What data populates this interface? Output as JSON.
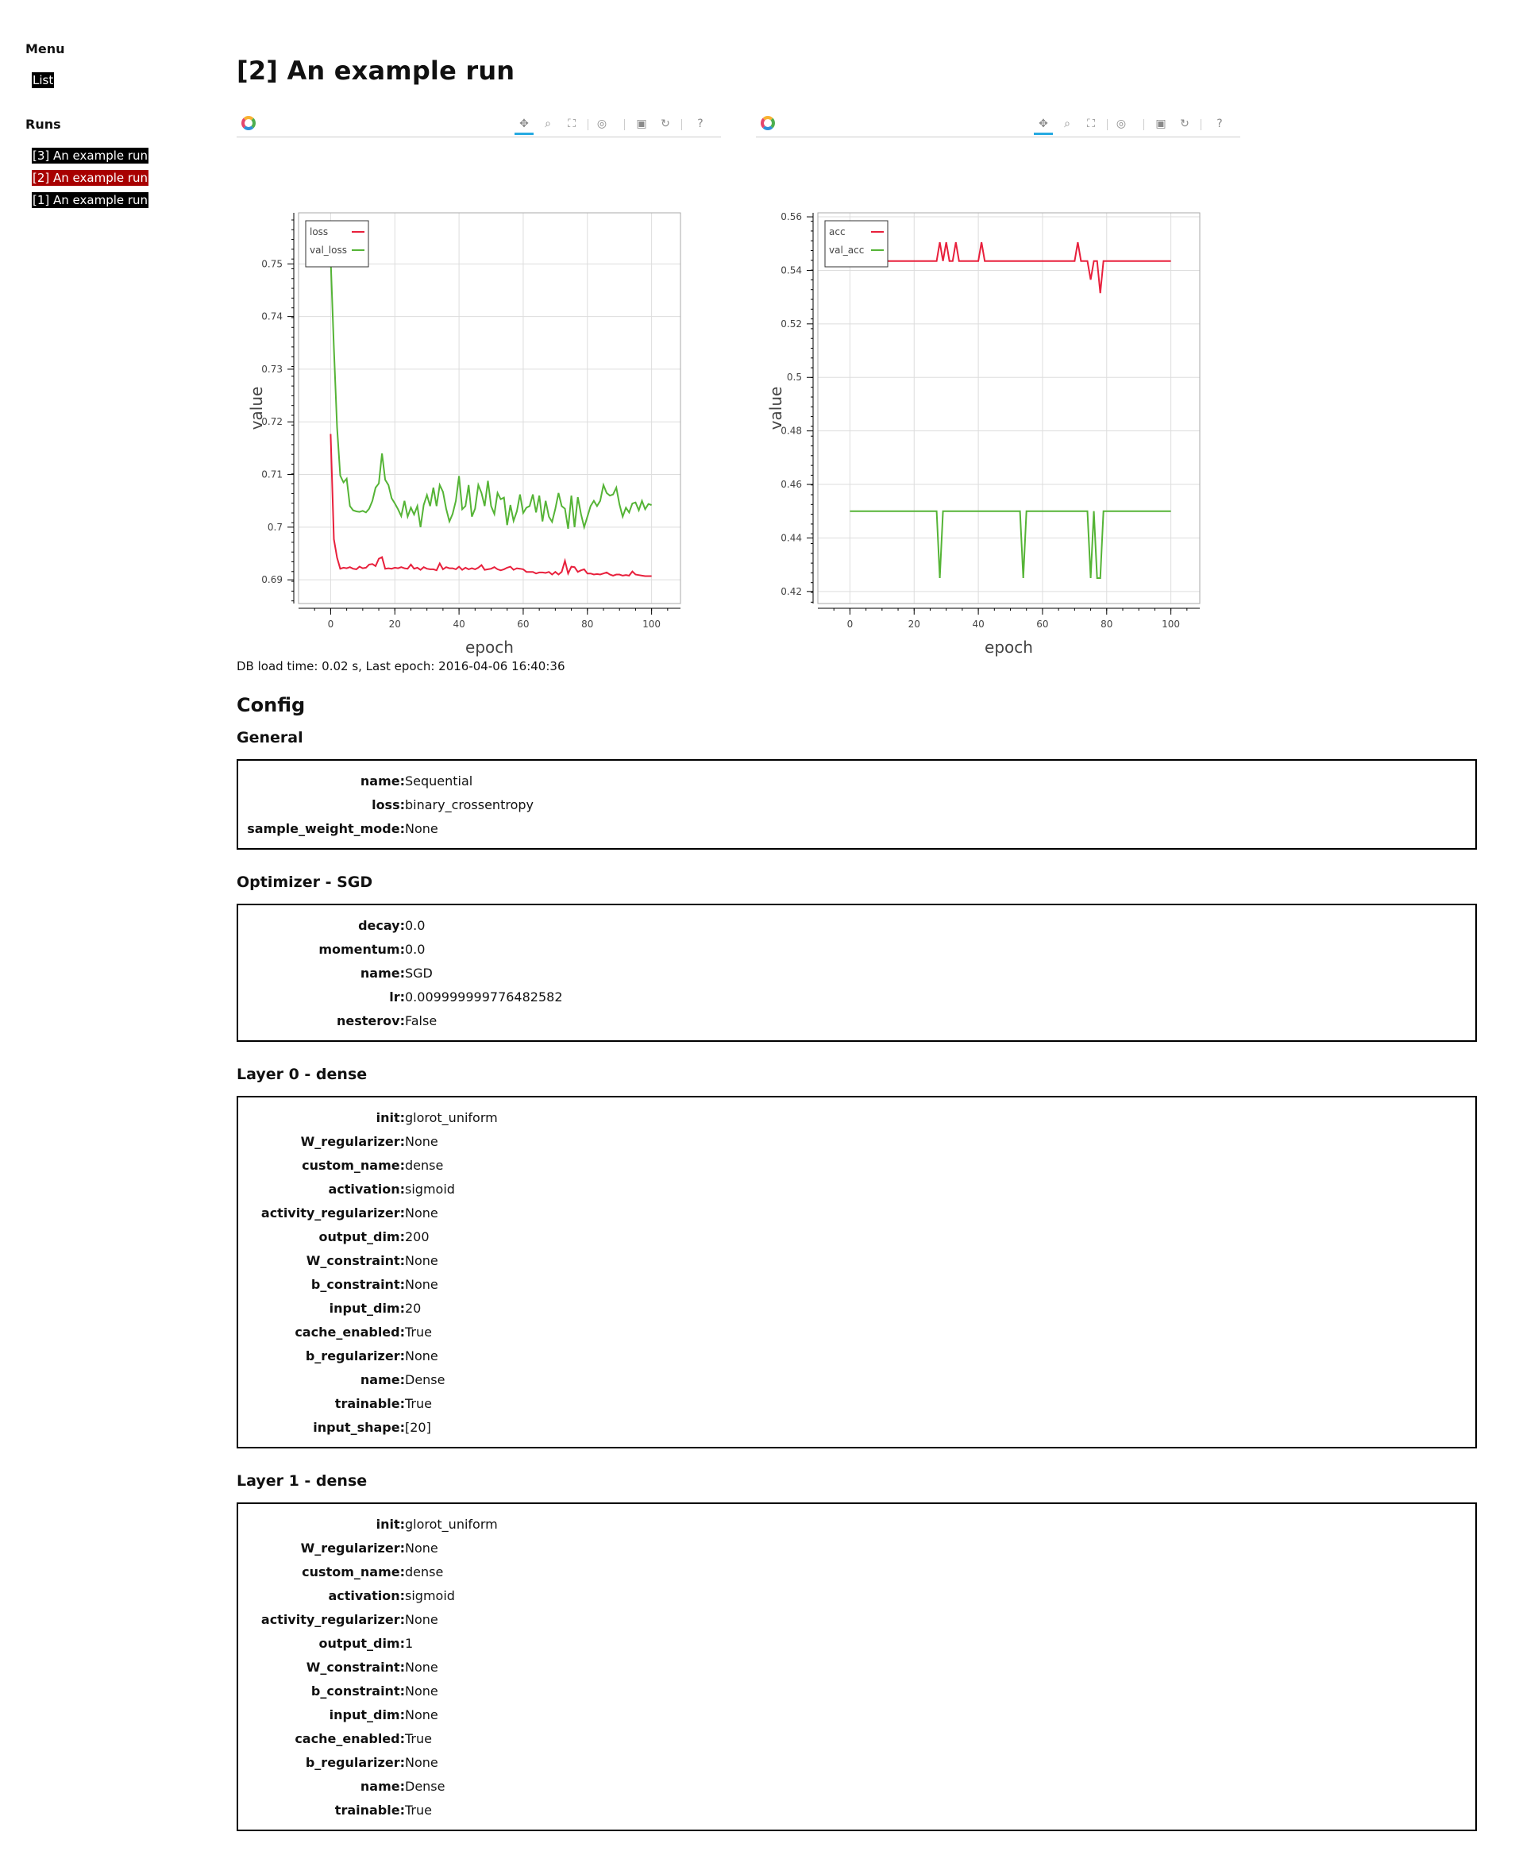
{
  "sidebar": {
    "menu_heading": "Menu",
    "menu_items": [
      {
        "label": "List"
      }
    ],
    "runs_heading": "Runs",
    "runs": [
      {
        "label": "[3] An example run",
        "active": false
      },
      {
        "label": "[2] An example run",
        "active": true
      },
      {
        "label": "[1] An example run",
        "active": false
      }
    ]
  },
  "page": {
    "title": "[2] An example run",
    "db_load": "DB load time: 0.02 s, Last epoch: 2016-04-06 16:40:36"
  },
  "toolbar": {
    "icons": [
      "pan-icon",
      "box-zoom-icon",
      "resize-icon",
      "wheel-zoom-icon",
      "save-icon",
      "reset-icon",
      "help-icon"
    ],
    "active": "pan-icon"
  },
  "colors": {
    "series1": "#e8203c",
    "series2": "#55b436",
    "grid": "#dddddd"
  },
  "chart_data": [
    {
      "type": "line",
      "xlabel": "epoch",
      "ylabel": "value",
      "xlim": [
        -10,
        109
      ],
      "ylim": [
        0.6855,
        0.7597
      ],
      "xticks": [
        0,
        20,
        40,
        60,
        80,
        100
      ],
      "yticks": [
        0.69,
        0.7,
        0.71,
        0.72,
        0.73,
        0.74,
        0.75
      ],
      "ytick_labels": [
        "0.69",
        "0.7",
        "0.71",
        "0.72",
        "0.73",
        "0.74",
        "0.75"
      ],
      "legend_position": "top-left",
      "series": [
        {
          "name": "loss",
          "color": "#e8203c",
          "x_start": 0,
          "x_step": 1,
          "values": [
            0.7177,
            0.6977,
            0.6942,
            0.6921,
            0.6923,
            0.6922,
            0.6924,
            0.6921,
            0.692,
            0.6925,
            0.6922,
            0.6923,
            0.6929,
            0.693,
            0.6926,
            0.694,
            0.6943,
            0.6921,
            0.6922,
            0.6921,
            0.6923,
            0.6922,
            0.6924,
            0.6922,
            0.6921,
            0.6929,
            0.6921,
            0.6923,
            0.6919,
            0.6924,
            0.6921,
            0.692,
            0.692,
            0.6918,
            0.6931,
            0.692,
            0.6924,
            0.6922,
            0.6922,
            0.692,
            0.6925,
            0.6919,
            0.6923,
            0.692,
            0.6922,
            0.692,
            0.6923,
            0.6928,
            0.6919,
            0.692,
            0.6921,
            0.6924,
            0.692,
            0.6918,
            0.692,
            0.6923,
            0.6925,
            0.6919,
            0.6922,
            0.6921,
            0.692,
            0.6915,
            0.6915,
            0.6915,
            0.6912,
            0.6914,
            0.6914,
            0.6913,
            0.6915,
            0.691,
            0.6915,
            0.691,
            0.6915,
            0.6936,
            0.6912,
            0.6925,
            0.6924,
            0.6915,
            0.6918,
            0.692,
            0.6912,
            0.6912,
            0.691,
            0.6911,
            0.691,
            0.6912,
            0.6914,
            0.691,
            0.6908,
            0.691,
            0.691,
            0.6908,
            0.6909,
            0.6908,
            0.6916,
            0.691,
            0.6909,
            0.6908,
            0.6907,
            0.6907,
            0.6907
          ]
        },
        {
          "name": "val_loss",
          "color": "#55b436",
          "x_start": 0,
          "x_step": 1,
          "values": [
            0.7512,
            0.734,
            0.719,
            0.7098,
            0.7085,
            0.7092,
            0.704,
            0.7032,
            0.703,
            0.7029,
            0.7031,
            0.7028,
            0.7035,
            0.705,
            0.7075,
            0.7083,
            0.714,
            0.709,
            0.708,
            0.7055,
            0.7045,
            0.7034,
            0.7021,
            0.705,
            0.702,
            0.7037,
            0.7024,
            0.704,
            0.7,
            0.7042,
            0.7061,
            0.704,
            0.7075,
            0.704,
            0.708,
            0.7067,
            0.7035,
            0.7011,
            0.7025,
            0.705,
            0.7097,
            0.7034,
            0.704,
            0.708,
            0.702,
            0.7035,
            0.708,
            0.7065,
            0.704,
            0.7088,
            0.704,
            0.7025,
            0.7065,
            0.7053,
            0.7056,
            0.7004,
            0.7042,
            0.7012,
            0.703,
            0.7062,
            0.7027,
            0.7037,
            0.704,
            0.7062,
            0.7028,
            0.706,
            0.7011,
            0.705,
            0.702,
            0.701,
            0.7035,
            0.7065,
            0.704,
            0.7035,
            0.6997,
            0.706,
            0.7,
            0.7057,
            0.7025,
            0.7,
            0.702,
            0.704,
            0.705,
            0.704,
            0.705,
            0.708,
            0.7065,
            0.706,
            0.7062,
            0.7075,
            0.7043,
            0.702,
            0.7037,
            0.7028,
            0.7045,
            0.7047,
            0.7032,
            0.705,
            0.7034,
            0.7044,
            0.7042
          ]
        }
      ]
    },
    {
      "type": "line",
      "xlabel": "epoch",
      "ylabel": "value",
      "xlim": [
        -10,
        109
      ],
      "ylim": [
        0.4155,
        0.5615
      ],
      "xticks": [
        0,
        20,
        40,
        60,
        80,
        100
      ],
      "yticks": [
        0.42,
        0.44,
        0.46,
        0.48,
        0.5,
        0.52,
        0.54,
        0.56
      ],
      "ytick_labels": [
        "0.42",
        "0.44",
        "0.46",
        "0.48",
        "0.5",
        "0.52",
        "0.54",
        "0.56"
      ],
      "legend_position": "top-left",
      "series": [
        {
          "name": "acc",
          "color": "#e8203c",
          "x_start": 0,
          "x_step": 1,
          "values": [
            0.5435,
            0.5435,
            0.5435,
            0.5435,
            0.5435,
            0.5435,
            0.5435,
            0.5435,
            0.5435,
            0.5435,
            0.5435,
            0.5435,
            0.5435,
            0.5435,
            0.5435,
            0.5435,
            0.5435,
            0.5435,
            0.5435,
            0.5435,
            0.5435,
            0.5435,
            0.5435,
            0.5435,
            0.5435,
            0.5435,
            0.5435,
            0.5435,
            0.5505,
            0.5435,
            0.5505,
            0.5435,
            0.5435,
            0.5505,
            0.5435,
            0.5435,
            0.5435,
            0.5435,
            0.5435,
            0.5435,
            0.5435,
            0.5505,
            0.5435,
            0.5435,
            0.5435,
            0.5435,
            0.5435,
            0.5435,
            0.5435,
            0.5435,
            0.5435,
            0.5435,
            0.5435,
            0.5435,
            0.5435,
            0.5435,
            0.5435,
            0.5435,
            0.5435,
            0.5435,
            0.5435,
            0.5435,
            0.5435,
            0.5435,
            0.5435,
            0.5435,
            0.5435,
            0.5435,
            0.5435,
            0.5435,
            0.5435,
            0.5505,
            0.5435,
            0.5435,
            0.5435,
            0.5365,
            0.5435,
            0.5435,
            0.5315,
            0.5435,
            0.5435,
            0.5435,
            0.5435,
            0.5435,
            0.5435,
            0.5435,
            0.5435,
            0.5435,
            0.5435,
            0.5435,
            0.5435,
            0.5435,
            0.5435,
            0.5435,
            0.5435,
            0.5435,
            0.5435,
            0.5435,
            0.5435,
            0.5435,
            0.5435
          ]
        },
        {
          "name": "val_acc",
          "color": "#55b436",
          "x_start": 0,
          "x_step": 1,
          "values": [
            0.45,
            0.45,
            0.45,
            0.45,
            0.45,
            0.45,
            0.45,
            0.45,
            0.45,
            0.45,
            0.45,
            0.45,
            0.45,
            0.45,
            0.45,
            0.45,
            0.45,
            0.45,
            0.45,
            0.45,
            0.45,
            0.45,
            0.45,
            0.45,
            0.45,
            0.45,
            0.45,
            0.45,
            0.425,
            0.45,
            0.45,
            0.45,
            0.45,
            0.45,
            0.45,
            0.45,
            0.45,
            0.45,
            0.45,
            0.45,
            0.45,
            0.45,
            0.45,
            0.45,
            0.45,
            0.45,
            0.45,
            0.45,
            0.45,
            0.45,
            0.45,
            0.45,
            0.45,
            0.45,
            0.425,
            0.45,
            0.45,
            0.45,
            0.45,
            0.45,
            0.45,
            0.45,
            0.45,
            0.45,
            0.45,
            0.45,
            0.45,
            0.45,
            0.45,
            0.45,
            0.45,
            0.45,
            0.45,
            0.45,
            0.45,
            0.425,
            0.45,
            0.425,
            0.425,
            0.45,
            0.45,
            0.45,
            0.45,
            0.45,
            0.45,
            0.45,
            0.45,
            0.45,
            0.45,
            0.45,
            0.45,
            0.45,
            0.45,
            0.45,
            0.45,
            0.45,
            0.45,
            0.45,
            0.45,
            0.45,
            0.45
          ]
        }
      ]
    }
  ],
  "config": {
    "heading": "Config",
    "sections": [
      {
        "title": "General",
        "rows": [
          {
            "key": "name:",
            "value": "Sequential"
          },
          {
            "key": "loss:",
            "value": "binary_crossentropy"
          },
          {
            "key": "sample_weight_mode:",
            "value": "None"
          }
        ]
      },
      {
        "title": "Optimizer - SGD",
        "rows": [
          {
            "key": "decay:",
            "value": "0.0"
          },
          {
            "key": "momentum:",
            "value": "0.0"
          },
          {
            "key": "name:",
            "value": "SGD"
          },
          {
            "key": "lr:",
            "value": "0.009999999776482582"
          },
          {
            "key": "nesterov:",
            "value": "False"
          }
        ]
      },
      {
        "title": "Layer 0 - dense",
        "rows": [
          {
            "key": "init:",
            "value": "glorot_uniform"
          },
          {
            "key": "W_regularizer:",
            "value": "None"
          },
          {
            "key": "custom_name:",
            "value": "dense"
          },
          {
            "key": "activation:",
            "value": "sigmoid"
          },
          {
            "key": "activity_regularizer:",
            "value": "None"
          },
          {
            "key": "output_dim:",
            "value": "200"
          },
          {
            "key": "W_constraint:",
            "value": "None"
          },
          {
            "key": "b_constraint:",
            "value": "None"
          },
          {
            "key": "input_dim:",
            "value": "20"
          },
          {
            "key": "cache_enabled:",
            "value": "True"
          },
          {
            "key": "b_regularizer:",
            "value": "None"
          },
          {
            "key": "name:",
            "value": "Dense"
          },
          {
            "key": "trainable:",
            "value": "True"
          },
          {
            "key": "input_shape:",
            "value": "[20]"
          }
        ]
      },
      {
        "title": "Layer 1 - dense",
        "rows": [
          {
            "key": "init:",
            "value": "glorot_uniform"
          },
          {
            "key": "W_regularizer:",
            "value": "None"
          },
          {
            "key": "custom_name:",
            "value": "dense"
          },
          {
            "key": "activation:",
            "value": "sigmoid"
          },
          {
            "key": "activity_regularizer:",
            "value": "None"
          },
          {
            "key": "output_dim:",
            "value": "1"
          },
          {
            "key": "W_constraint:",
            "value": "None"
          },
          {
            "key": "b_constraint:",
            "value": "None"
          },
          {
            "key": "input_dim:",
            "value": "None"
          },
          {
            "key": "cache_enabled:",
            "value": "True"
          },
          {
            "key": "b_regularizer:",
            "value": "None"
          },
          {
            "key": "name:",
            "value": "Dense"
          },
          {
            "key": "trainable:",
            "value": "True"
          }
        ]
      }
    ]
  }
}
